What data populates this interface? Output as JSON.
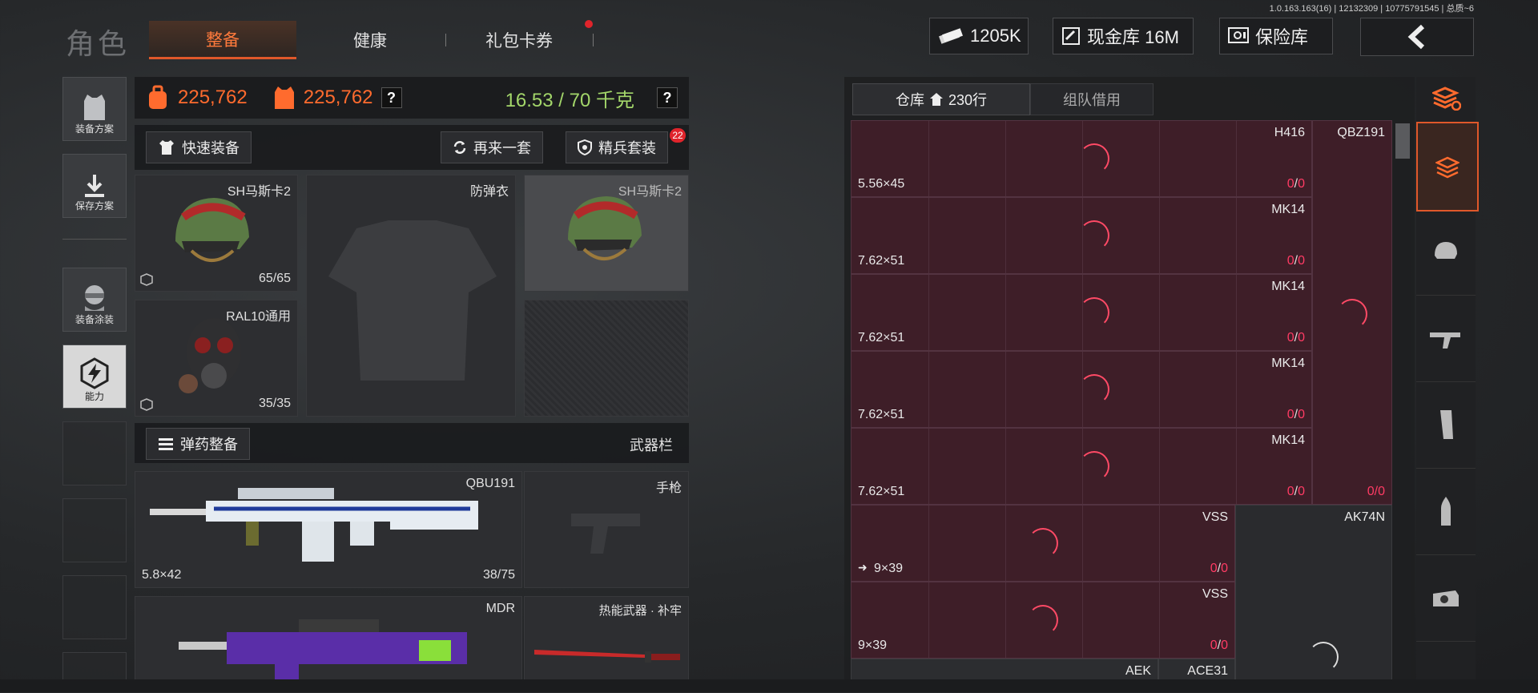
{
  "version": "1.0.163.163(16) | 12132309 | 10775791545 | 总质~6",
  "header": {
    "title": "角色",
    "tabs": [
      {
        "label": "整备",
        "active": true
      },
      {
        "label": "健康",
        "active": false
      },
      {
        "label": "礼包卡券",
        "active": false
      }
    ],
    "cash": "1205K",
    "vault_label": "现金库 16M",
    "safe_label": "保险库"
  },
  "sidebar": {
    "items": [
      {
        "label": "装备方案"
      },
      {
        "label": "保存方案"
      },
      {
        "label": "装备涂装"
      },
      {
        "label": "能力"
      }
    ]
  },
  "stats": {
    "value1": "225,762",
    "value2": "225,762",
    "weight": "16.53 / 70 千克",
    "help": "?"
  },
  "actions": {
    "quick_equip": "快速装备",
    "reroll": "再来一套",
    "elite_set": "精兵套装",
    "elite_badge": "22"
  },
  "gear": {
    "helmet": {
      "name": "SH马斯卡2",
      "count": "65/65"
    },
    "armor": {
      "name": "防弹衣"
    },
    "helmet2": {
      "name": "SH马斯卡2"
    },
    "mask": {
      "name": "RAL10通用",
      "count": "35/35"
    }
  },
  "weapons": {
    "ammo_btn": "弹药整备",
    "bar_label": "武器栏",
    "primary": {
      "name": "QBU191",
      "caliber": "5.8×42",
      "count": "38/75"
    },
    "pistol": {
      "name": "手枪"
    },
    "secondary": {
      "name": "MDR"
    },
    "melee": {
      "name": "热能武器 · 补牢"
    }
  },
  "warehouse": {
    "tab_label": "仓库",
    "rows": "230行",
    "team_tab": "组队借用",
    "rows_data": [
      {
        "name": "H416",
        "caliber": "5.56×45",
        "count_a": "0",
        "count_b": "0",
        "side": "QBZ191"
      },
      {
        "name": "MK14",
        "caliber": "7.62×51",
        "count_a": "0",
        "count_b": "0",
        "side": ""
      },
      {
        "name": "MK14",
        "caliber": "7.62×51",
        "count_a": "0",
        "count_b": "0",
        "side": ""
      },
      {
        "name": "MK14",
        "caliber": "7.62×51",
        "count_a": "0",
        "count_b": "0",
        "side": ""
      },
      {
        "name": "MK14",
        "caliber": "7.62×51",
        "count_a": "0",
        "count_b": "0",
        "side_count": "0/0"
      },
      {
        "name": "VSS",
        "caliber": "9×39",
        "count_a": "0",
        "count_b": "0",
        "side": "AK74N"
      },
      {
        "name": "VSS",
        "caliber": "9×39",
        "count_a": "0",
        "count_b": "0",
        "side": ""
      }
    ],
    "bottom_labels": [
      "AEK",
      "ACE31"
    ]
  },
  "categories": [
    "全部",
    "头盔",
    "步枪",
    "弹匣",
    "弹药",
    "瞄具"
  ],
  "colors": {
    "accent": "#e0582a",
    "orange_text": "#ff6b2e",
    "green_text": "#a3d66a",
    "count_red": "#ff3b64",
    "cell_bg": "#3e1e28"
  }
}
